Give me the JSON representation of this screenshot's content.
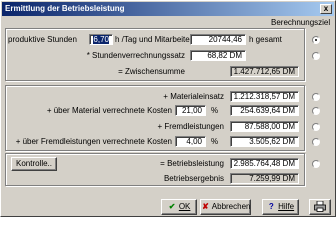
{
  "window": {
    "title": "Ermittlung der Betriebsleistung",
    "close_symbol": "x"
  },
  "header": {
    "berechnungsziel": "Berechnungsziel"
  },
  "row1": {
    "label_pre": "produktive Stunden",
    "stunden": "6,70",
    "label_post": "h /Tag und Mitarbeiter",
    "gesamt_value": "20744,46",
    "gesamt_unit": "h gesamt"
  },
  "row2": {
    "label": "* Stundenverrechnungssatz",
    "value": "68,82 DM"
  },
  "row3": {
    "label": "= Zwischensumme",
    "value": "1.427.712,65 DM"
  },
  "row4": {
    "label": "+ Materialeinsatz",
    "value": "1.212.318,57 DM"
  },
  "row5": {
    "label": "+ über Material verrechnete Kosten",
    "percent": "21,00",
    "percent_sign": "%",
    "value": "254.639,64 DM"
  },
  "row6": {
    "label": "+ Fremdleistungen",
    "value": "87.588,00 DM"
  },
  "row7": {
    "label": "+ über Fremdleistungen verrechnete Kosten",
    "percent": "4,00",
    "percent_sign": "%",
    "value": "3.505,62 DM"
  },
  "bottom": {
    "kontrolle_label": "Kontrolle..",
    "betriebsleistung_label": "= Betriebsleistung",
    "betriebsleistung_value": "2.985.764,48 DM",
    "ergebnis_label": "Betriebsergebnis",
    "ergebnis_value": "7.259,99 DM"
  },
  "buttons": {
    "ok": "OK",
    "abbrechen": "Abbrechen",
    "hilfe": "Hilfe",
    "print_icon": "printer-icon"
  },
  "colors": {
    "titlebar_start": "#0a246a",
    "titlebar_end": "#a6caf0",
    "dialog_bg": "#d4d0c8",
    "selection": "#0a246a"
  }
}
